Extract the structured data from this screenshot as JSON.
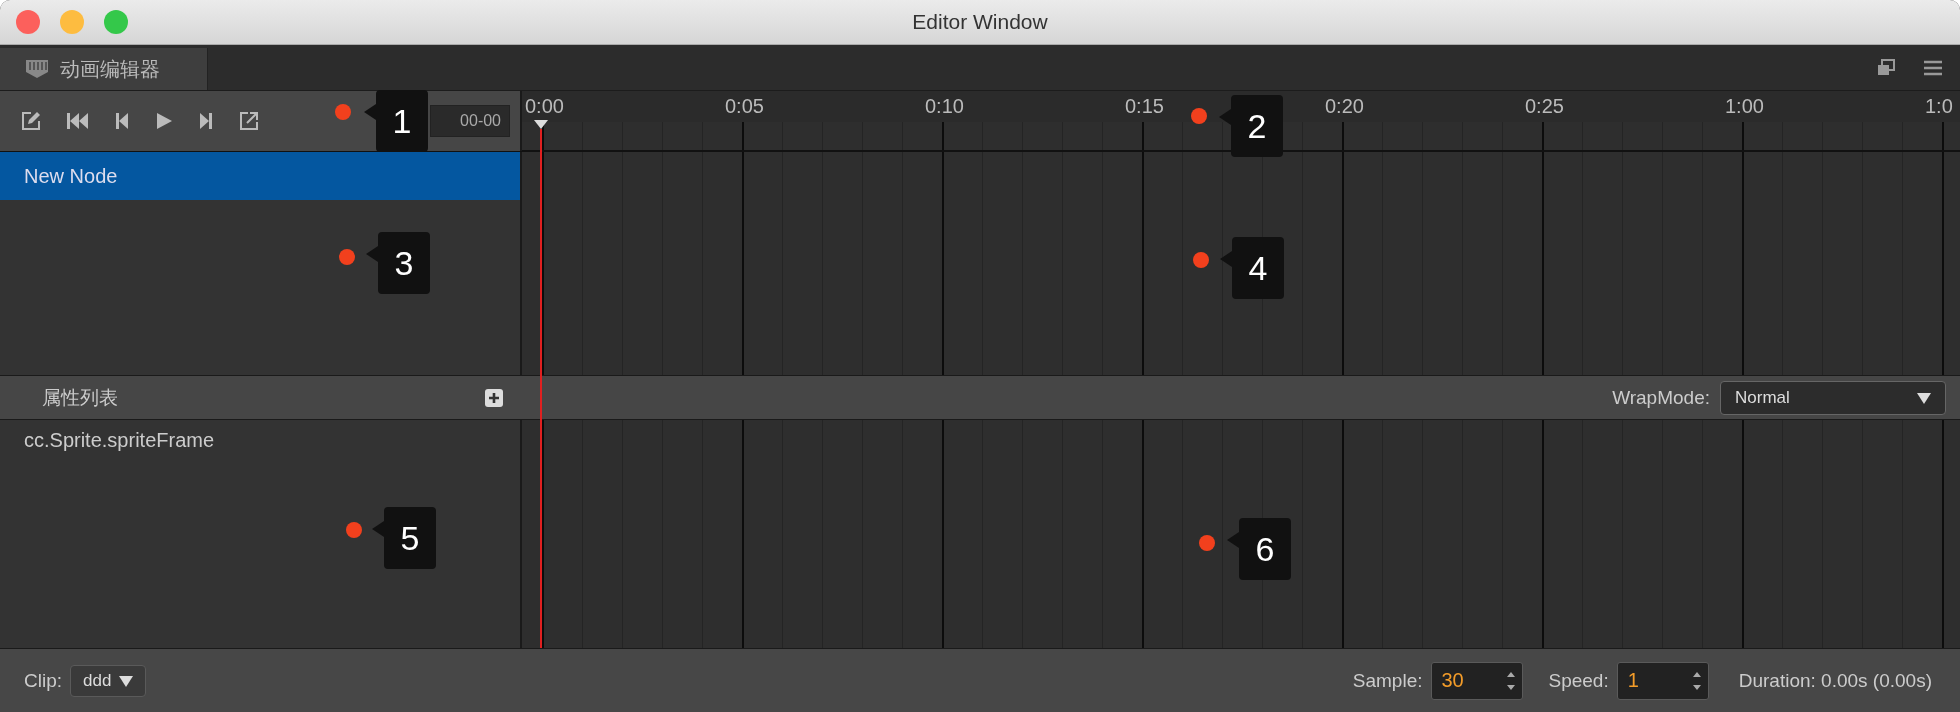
{
  "window": {
    "title": "Editor Window"
  },
  "tab": {
    "label": "动画编辑器"
  },
  "toolbar": {
    "time": "00-00"
  },
  "ruler": {
    "labels": [
      "0:00",
      "0:05",
      "0:10",
      "0:15",
      "0:20",
      "0:25",
      "1:00",
      "1:0"
    ]
  },
  "nodes": [
    {
      "name": "New Node",
      "selected": true
    }
  ],
  "properties": {
    "title": "属性列表",
    "wrap_mode_label": "WrapMode:",
    "wrap_mode": "Normal",
    "items": [
      {
        "name": "cc.Sprite.spriteFrame"
      }
    ]
  },
  "bottom": {
    "clip_label": "Clip:",
    "clip": "ddd",
    "sample_label": "Sample:",
    "sample": "30",
    "speed_label": "Speed:",
    "speed": "1",
    "duration": "Duration: 0.00s (0.00s)"
  },
  "callouts": [
    {
      "label": "1"
    },
    {
      "label": "2"
    },
    {
      "label": "3"
    },
    {
      "label": "4"
    },
    {
      "label": "5"
    },
    {
      "label": "6"
    }
  ]
}
